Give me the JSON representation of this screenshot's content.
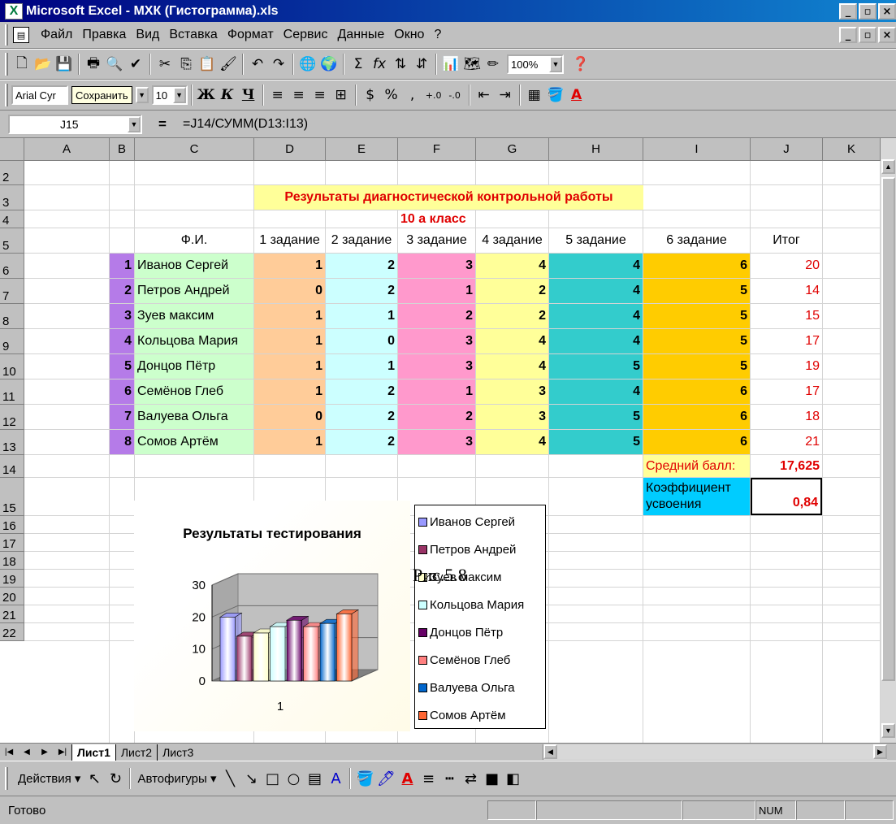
{
  "window": {
    "title": "Microsoft Excel - МХК (Гистограмма).xls",
    "logo": "X"
  },
  "menu": [
    "Файл",
    "Правка",
    "Вид",
    "Вставка",
    "Формат",
    "Сервис",
    "Данные",
    "Окно",
    "?"
  ],
  "toolbar": {
    "zoom": "100%",
    "font_name": "Arial Cyr",
    "tooltip": "Сохранить",
    "font_size": "10"
  },
  "formula_bar": {
    "name_box": "J15",
    "equals": "=",
    "formula": "=J14/СУММ(D13:I13)"
  },
  "columns": [
    "A",
    "B",
    "C",
    "D",
    "E",
    "F",
    "G",
    "H",
    "I",
    "J",
    "K"
  ],
  "rows": [
    "2",
    "3",
    "4",
    "5",
    "6",
    "7",
    "8",
    "9",
    "10",
    "11",
    "12",
    "13",
    "14",
    "15",
    "16",
    "17",
    "18",
    "19",
    "20",
    "21",
    "22"
  ],
  "sheet": {
    "title": "Результаты диагностической контрольной работы",
    "subtitle": "10 а класс",
    "headers": {
      "name": "Ф.И.",
      "t1": "1 задание",
      "t2": "2 задание",
      "t3": "3 задание",
      "t4": "4 задание",
      "t5": "5 задание",
      "t6": "6 задание",
      "total": "Итог"
    },
    "students": [
      {
        "n": "1",
        "name": "Иванов Сергей",
        "s": [
          "1",
          "2",
          "3",
          "4",
          "4",
          "6"
        ],
        "total": "20"
      },
      {
        "n": "2",
        "name": "Петров Андрей",
        "s": [
          "0",
          "2",
          "1",
          "2",
          "4",
          "5"
        ],
        "total": "14"
      },
      {
        "n": "3",
        "name": "Зуев максим",
        "s": [
          "1",
          "1",
          "2",
          "2",
          "4",
          "5"
        ],
        "total": "15"
      },
      {
        "n": "4",
        "name": "Кольцова Мария",
        "s": [
          "1",
          "0",
          "3",
          "4",
          "4",
          "5"
        ],
        "total": "17"
      },
      {
        "n": "5",
        "name": "Донцов Пётр",
        "s": [
          "1",
          "1",
          "3",
          "4",
          "5",
          "5"
        ],
        "total": "19"
      },
      {
        "n": "6",
        "name": "Семёнов Глеб",
        "s": [
          "1",
          "2",
          "1",
          "3",
          "4",
          "6"
        ],
        "total": "17"
      },
      {
        "n": "7",
        "name": "Валуева Ольга",
        "s": [
          "0",
          "2",
          "2",
          "3",
          "5",
          "6"
        ],
        "total": "18"
      },
      {
        "n": "8",
        "name": "Сомов Артём",
        "s": [
          "1",
          "2",
          "3",
          "4",
          "5",
          "6"
        ],
        "total": "21"
      }
    ],
    "avg_label": "Средний балл:",
    "avg_value": "17,625",
    "coef_label_1": "Коэффициент",
    "coef_label_2": "усвоения",
    "coef_value": "0,84",
    "figure_caption": "Рис.5.8",
    "colors": {
      "num": "#b57be8",
      "name": "#ccffcc",
      "t1": "#ffcc99",
      "t2": "#ccffff",
      "t3": "#ff99cc",
      "t4": "#ffff99",
      "t5": "#33cccc",
      "t6": "#ffcc00",
      "title_bg": "#ffff99",
      "title_fg": "#e00000",
      "coef_bg": "#00ccff"
    }
  },
  "chart_data": {
    "type": "bar",
    "title": "Результаты тестирования",
    "categories": [
      "1"
    ],
    "ylim": [
      0,
      30
    ],
    "yticks": [
      "0",
      "10",
      "20",
      "30"
    ],
    "series": [
      {
        "name": "Иванов Сергей",
        "values": [
          20
        ],
        "color": "#9999ff"
      },
      {
        "name": "Петров Андрей",
        "values": [
          14
        ],
        "color": "#993366"
      },
      {
        "name": "Зуев максим",
        "values": [
          15
        ],
        "color": "#ffffcc"
      },
      {
        "name": "Кольцова Мария",
        "values": [
          17
        ],
        "color": "#ccffff"
      },
      {
        "name": "Донцов Пётр",
        "values": [
          19
        ],
        "color": "#660066"
      },
      {
        "name": "Семёнов Глеб",
        "values": [
          17
        ],
        "color": "#ff8080"
      },
      {
        "name": "Валуева Ольга",
        "values": [
          18
        ],
        "color": "#0066cc"
      },
      {
        "name": "Сомов Артём",
        "values": [
          21
        ],
        "color": "#ff6633"
      }
    ]
  },
  "tabs": [
    "Лист1",
    "Лист2",
    "Лист3"
  ],
  "drawing": {
    "actions": "Действия",
    "autoshapes": "Автофигуры"
  },
  "status": {
    "ready": "Готово",
    "num": "NUM"
  }
}
